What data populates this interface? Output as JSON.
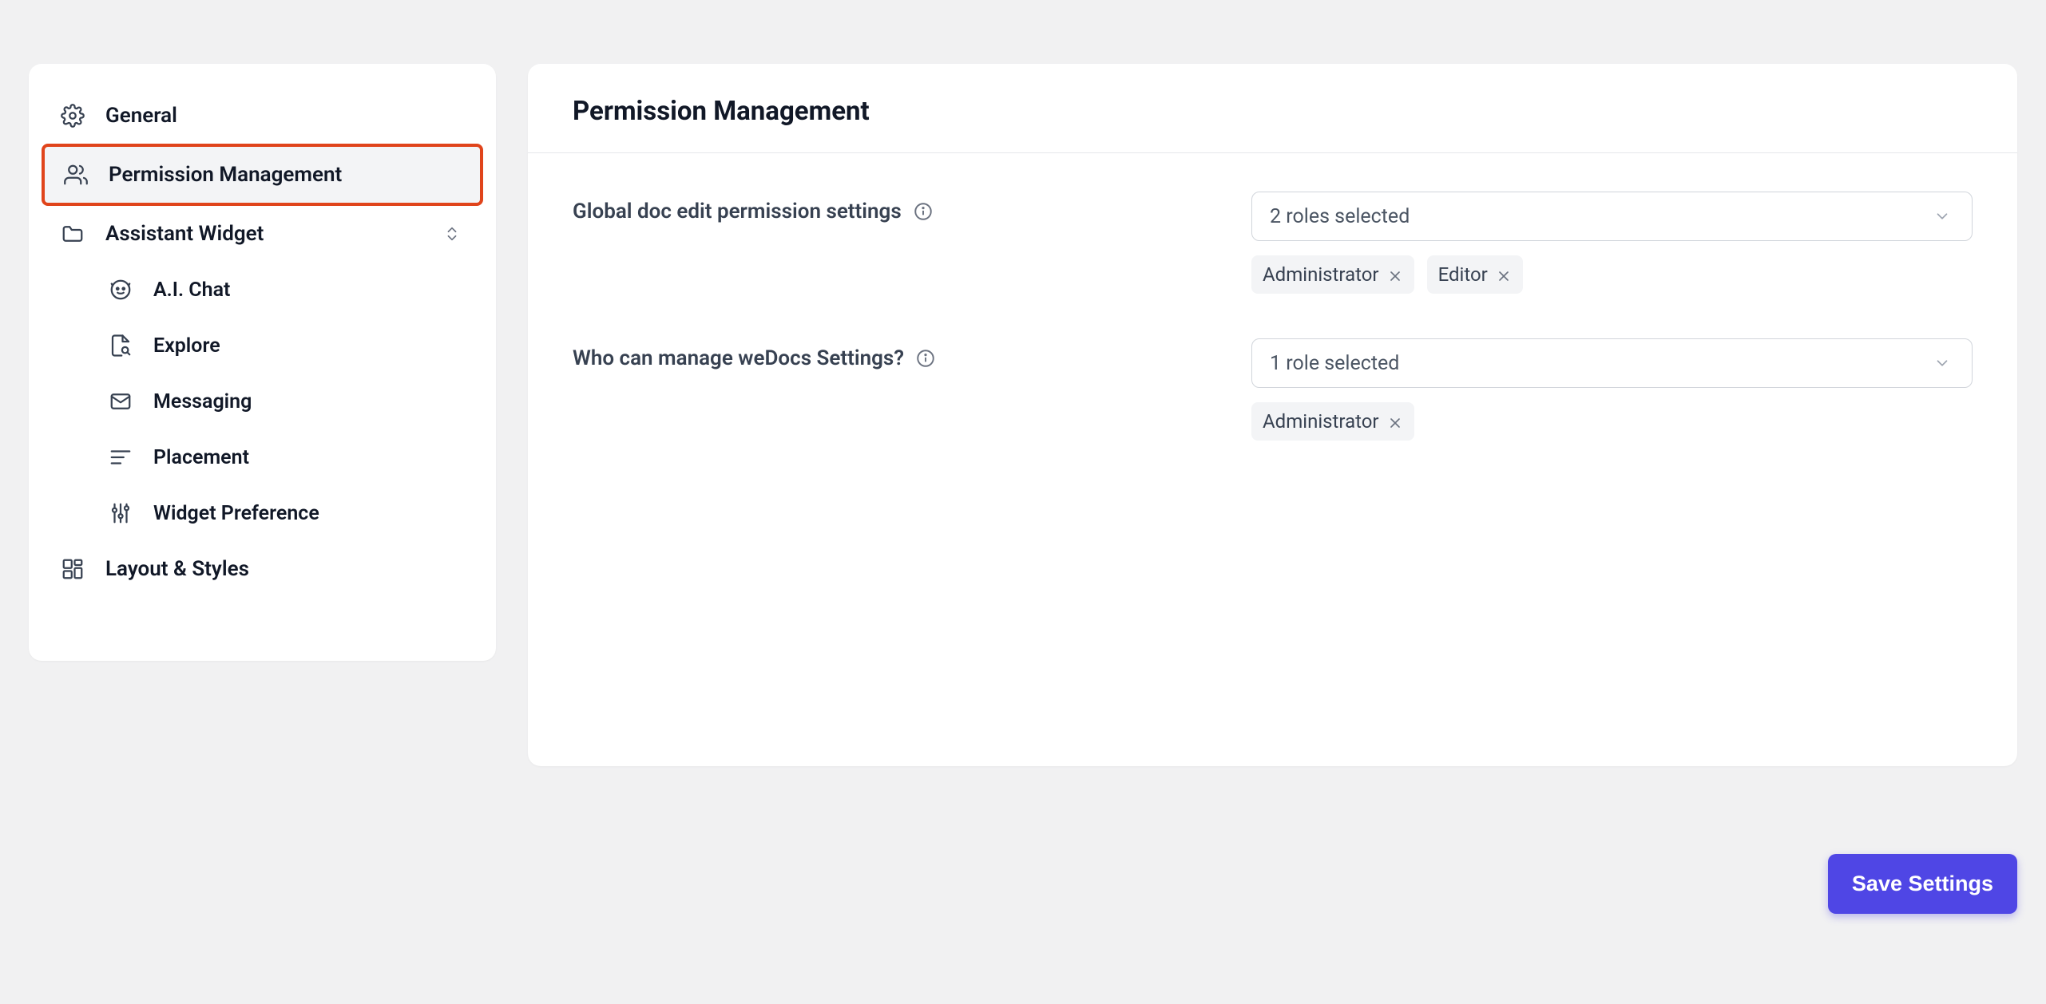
{
  "sidebar": {
    "general": "General",
    "permission": "Permission Management",
    "assistant": "Assistant Widget",
    "ai_chat": "A.I. Chat",
    "explore": "Explore",
    "messaging": "Messaging",
    "placement": "Placement",
    "widget_pref": "Widget Preference",
    "layout_styles": "Layout & Styles"
  },
  "main": {
    "title": "Permission Management",
    "global_edit_label": "Global doc edit permission settings",
    "global_edit_select": "2 roles selected",
    "global_edit_chips": [
      "Administrator",
      "Editor"
    ],
    "manage_label": "Who can manage weDocs Settings?",
    "manage_select": "1 role selected",
    "manage_chips": [
      "Administrator"
    ]
  },
  "save_button": "Save Settings"
}
